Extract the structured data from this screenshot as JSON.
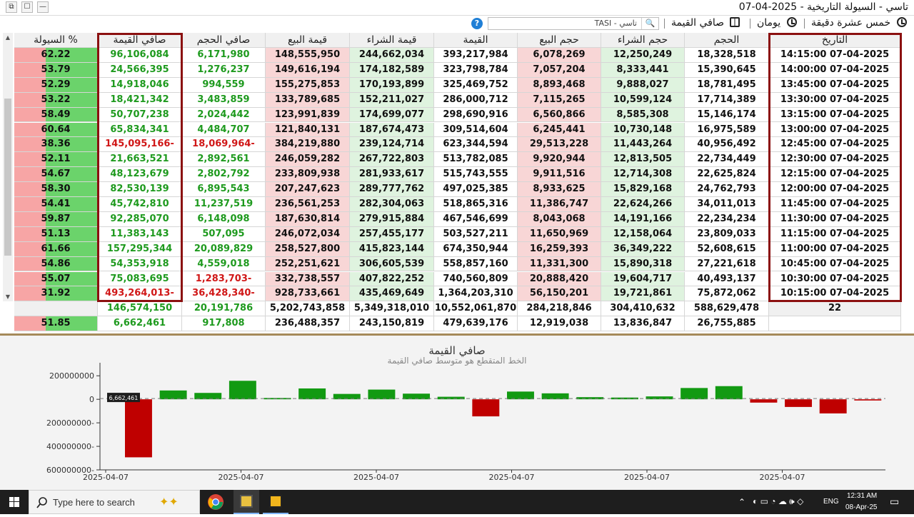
{
  "window": {
    "title": "تاسي - السيولة التاريخية - 2025-04-07",
    "buttons": [
      "⧉",
      "☐",
      "—"
    ]
  },
  "toolbar": {
    "interval_label": "خمس عشرة دقيقة",
    "period_label": "يومان",
    "metric_label": "صافي القيمة",
    "search_value": "TASI - تاسي",
    "help_label": "?"
  },
  "table": {
    "headers": [
      "التاريخ",
      "الحجم",
      "حجم الشراء",
      "حجم البيع",
      "القيمة",
      "قيمة الشراء",
      "قيمة البيع",
      "صافي الحجم",
      "صافي القيمة",
      "السيولة %"
    ],
    "rows": [
      {
        "date": "14:15:00 07-04-2025",
        "volume": "18,328,518",
        "buy_volume": "12,250,249",
        "sell_volume": "6,078,269",
        "value": "393,217,984",
        "buy_value": "244,662,034",
        "sell_value": "148,555,950",
        "net_volume": "6,171,980",
        "net_value": "96,106,084",
        "liquidity": "62.22",
        "net_volume_sign": "pos",
        "net_value_sign": "pos"
      },
      {
        "date": "14:00:00 07-04-2025",
        "volume": "15,390,645",
        "buy_volume": "8,333,441",
        "sell_volume": "7,057,204",
        "value": "323,798,784",
        "buy_value": "174,182,589",
        "sell_value": "149,616,194",
        "net_volume": "1,276,237",
        "net_value": "24,566,395",
        "liquidity": "53.79",
        "net_volume_sign": "pos",
        "net_value_sign": "pos"
      },
      {
        "date": "13:45:00 07-04-2025",
        "volume": "18,781,495",
        "buy_volume": "9,888,027",
        "sell_volume": "8,893,468",
        "value": "325,469,752",
        "buy_value": "170,193,899",
        "sell_value": "155,275,853",
        "net_volume": "994,559",
        "net_value": "14,918,046",
        "liquidity": "52.29",
        "net_volume_sign": "pos",
        "net_value_sign": "pos"
      },
      {
        "date": "13:30:00 07-04-2025",
        "volume": "17,714,389",
        "buy_volume": "10,599,124",
        "sell_volume": "7,115,265",
        "value": "286,000,712",
        "buy_value": "152,211,027",
        "sell_value": "133,789,685",
        "net_volume": "3,483,859",
        "net_value": "18,421,342",
        "liquidity": "53.22",
        "net_volume_sign": "pos",
        "net_value_sign": "pos"
      },
      {
        "date": "13:15:00 07-04-2025",
        "volume": "15,146,174",
        "buy_volume": "8,585,308",
        "sell_volume": "6,560,866",
        "value": "298,690,916",
        "buy_value": "174,699,077",
        "sell_value": "123,991,839",
        "net_volume": "2,024,442",
        "net_value": "50,707,238",
        "liquidity": "58.49",
        "net_volume_sign": "pos",
        "net_value_sign": "pos"
      },
      {
        "date": "13:00:00 07-04-2025",
        "volume": "16,975,589",
        "buy_volume": "10,730,148",
        "sell_volume": "6,245,441",
        "value": "309,514,604",
        "buy_value": "187,674,473",
        "sell_value": "121,840,131",
        "net_volume": "4,484,707",
        "net_value": "65,834,341",
        "liquidity": "60.64",
        "net_volume_sign": "pos",
        "net_value_sign": "pos"
      },
      {
        "date": "12:45:00 07-04-2025",
        "volume": "40,956,492",
        "buy_volume": "11,443,264",
        "sell_volume": "29,513,228",
        "value": "623,344,594",
        "buy_value": "239,124,714",
        "sell_value": "384,219,880",
        "net_volume": "18,069,964-",
        "net_value": "145,095,166-",
        "liquidity": "38.36",
        "net_volume_sign": "neg",
        "net_value_sign": "neg"
      },
      {
        "date": "12:30:00 07-04-2025",
        "volume": "22,734,449",
        "buy_volume": "12,813,505",
        "sell_volume": "9,920,944",
        "value": "513,782,085",
        "buy_value": "267,722,803",
        "sell_value": "246,059,282",
        "net_volume": "2,892,561",
        "net_value": "21,663,521",
        "liquidity": "52.11",
        "net_volume_sign": "pos",
        "net_value_sign": "pos"
      },
      {
        "date": "12:15:00 07-04-2025",
        "volume": "22,625,824",
        "buy_volume": "12,714,308",
        "sell_volume": "9,911,516",
        "value": "515,743,555",
        "buy_value": "281,933,617",
        "sell_value": "233,809,938",
        "net_volume": "2,802,792",
        "net_value": "48,123,679",
        "liquidity": "54.67",
        "net_volume_sign": "pos",
        "net_value_sign": "pos"
      },
      {
        "date": "12:00:00 07-04-2025",
        "volume": "24,762,793",
        "buy_volume": "15,829,168",
        "sell_volume": "8,933,625",
        "value": "497,025,385",
        "buy_value": "289,777,762",
        "sell_value": "207,247,623",
        "net_volume": "6,895,543",
        "net_value": "82,530,139",
        "liquidity": "58.30",
        "net_volume_sign": "pos",
        "net_value_sign": "pos"
      },
      {
        "date": "11:45:00 07-04-2025",
        "volume": "34,011,013",
        "buy_volume": "22,624,266",
        "sell_volume": "11,386,747",
        "value": "518,865,316",
        "buy_value": "282,304,063",
        "sell_value": "236,561,253",
        "net_volume": "11,237,519",
        "net_value": "45,742,810",
        "liquidity": "54.41",
        "net_volume_sign": "pos",
        "net_value_sign": "pos"
      },
      {
        "date": "11:30:00 07-04-2025",
        "volume": "22,234,234",
        "buy_volume": "14,191,166",
        "sell_volume": "8,043,068",
        "value": "467,546,699",
        "buy_value": "279,915,884",
        "sell_value": "187,630,814",
        "net_volume": "6,148,098",
        "net_value": "92,285,070",
        "liquidity": "59.87",
        "net_volume_sign": "pos",
        "net_value_sign": "pos"
      },
      {
        "date": "11:15:00 07-04-2025",
        "volume": "23,809,033",
        "buy_volume": "12,158,064",
        "sell_volume": "11,650,969",
        "value": "503,527,211",
        "buy_value": "257,455,177",
        "sell_value": "246,072,034",
        "net_volume": "507,095",
        "net_value": "11,383,143",
        "liquidity": "51.13",
        "net_volume_sign": "pos",
        "net_value_sign": "pos"
      },
      {
        "date": "11:00:00 07-04-2025",
        "volume": "52,608,615",
        "buy_volume": "36,349,222",
        "sell_volume": "16,259,393",
        "value": "674,350,944",
        "buy_value": "415,823,144",
        "sell_value": "258,527,800",
        "net_volume": "20,089,829",
        "net_value": "157,295,344",
        "liquidity": "61.66",
        "net_volume_sign": "pos",
        "net_value_sign": "pos"
      },
      {
        "date": "10:45:00 07-04-2025",
        "volume": "27,221,618",
        "buy_volume": "15,890,318",
        "sell_volume": "11,331,300",
        "value": "558,857,160",
        "buy_value": "306,605,539",
        "sell_value": "252,251,621",
        "net_volume": "4,559,018",
        "net_value": "54,353,918",
        "liquidity": "54.86",
        "net_volume_sign": "pos",
        "net_value_sign": "pos"
      },
      {
        "date": "10:30:00 07-04-2025",
        "volume": "40,493,137",
        "buy_volume": "19,604,717",
        "sell_volume": "20,888,420",
        "value": "740,560,809",
        "buy_value": "407,822,252",
        "sell_value": "332,738,557",
        "net_volume": "1,283,703-",
        "net_value": "75,083,695",
        "liquidity": "55.07",
        "net_volume_sign": "neg",
        "net_value_sign": "pos"
      },
      {
        "date": "10:15:00 07-04-2025",
        "volume": "75,872,062",
        "buy_volume": "19,721,861",
        "sell_volume": "56,150,201",
        "value": "1,364,203,310",
        "buy_value": "435,469,649",
        "sell_value": "928,733,661",
        "net_volume": "36,428,340-",
        "net_value": "493,264,013-",
        "liquidity": "31.92",
        "net_volume_sign": "neg",
        "net_value_sign": "neg"
      }
    ],
    "totals": {
      "date": "22",
      "volume": "588,629,478",
      "buy_volume": "304,410,632",
      "sell_volume": "284,218,846",
      "value": "10,552,061,870",
      "buy_value": "5,349,318,010",
      "sell_value": "5,202,743,858",
      "net_volume": "20,191,786",
      "net_value": "146,574,150",
      "liquidity": ""
    },
    "averages": {
      "date": "",
      "volume": "26,755,885",
      "buy_volume": "13,836,847",
      "sell_volume": "12,919,038",
      "value": "479,639,176",
      "buy_value": "243,150,819",
      "sell_value": "236,488,357",
      "net_volume": "917,808",
      "net_value": "6,662,461",
      "liquidity": "51.85"
    }
  },
  "chart_data": {
    "type": "bar",
    "title": "صافي القيمة",
    "subtitle": "الخط المتقطع هو متوسط صافي القيمة",
    "x_tick_labels": [
      "2025-04-07",
      "2025-04-07",
      "2025-04-07",
      "2025-04-07",
      "2025-04-07",
      "2025-04-07"
    ],
    "y_tick_labels": [
      "200000000",
      "0",
      "200000000-",
      "400000000-",
      "600000000-"
    ],
    "ylim": [
      -600000000,
      250000000
    ],
    "average_line": 6662461,
    "average_label": "6,662,461",
    "values": [
      -493264013,
      75083695,
      54353918,
      157295344,
      11383143,
      92285070,
      45742810,
      82530139,
      48123679,
      21663521,
      -145095166,
      65834341,
      50707238,
      18421342,
      14918046,
      24566395,
      96106084,
      112000000,
      -28000000,
      -65000000,
      -120000000,
      -10000000
    ],
    "positive_color": "#129a12",
    "negative_color": "#bf0000"
  },
  "taskbar": {
    "search_placeholder": "Type here to search",
    "time": "12:31 AM",
    "date": "08-Apr-25",
    "language": "ENG"
  }
}
